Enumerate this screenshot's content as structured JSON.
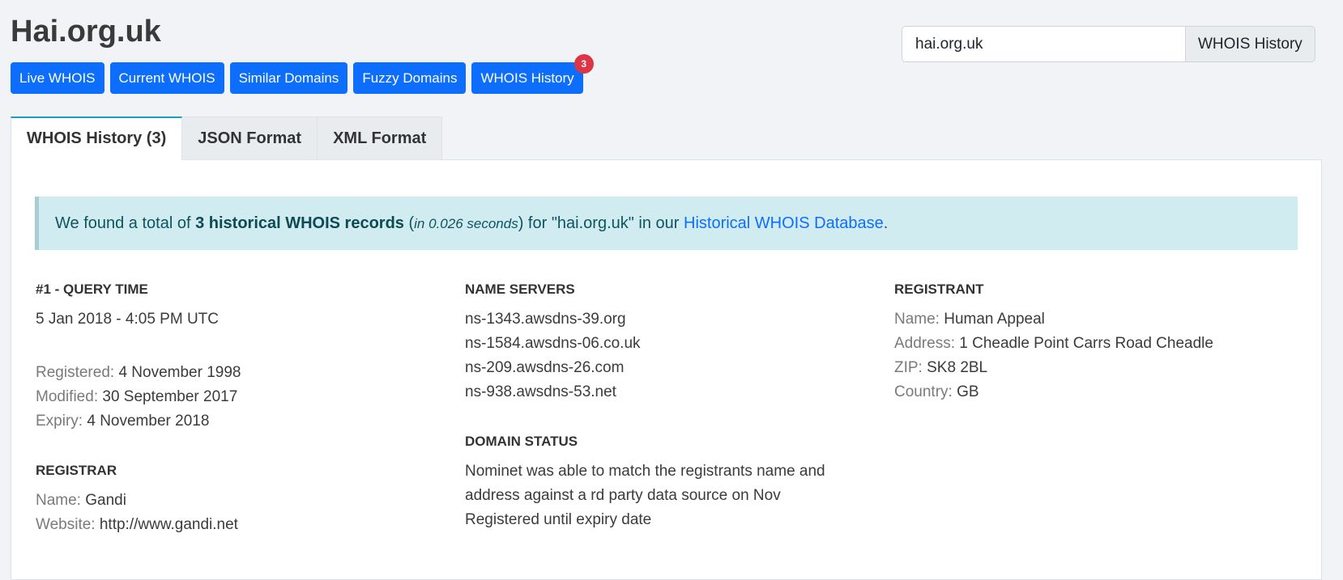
{
  "page": {
    "title": "Hai.org.uk"
  },
  "nav": {
    "buttons": [
      "Live WHOIS",
      "Current WHOIS",
      "Similar Domains",
      "Fuzzy Domains",
      "WHOIS History"
    ],
    "history_badge": "3"
  },
  "search": {
    "value": "hai.org.uk",
    "button_label": "WHOIS History"
  },
  "tabs": [
    "WHOIS History (3)",
    "JSON Format",
    "XML Format"
  ],
  "alert": {
    "prefix": "We found a total of ",
    "count_text": "3 historical WHOIS records",
    "paren_open": " (",
    "time_text": "in 0.026 seconds",
    "paren_close": ") for \"",
    "domain": "hai.org.uk",
    "middle": "\" in our ",
    "link_text": "Historical WHOIS Database",
    "suffix": "."
  },
  "record": {
    "query_heading": "#1 - QUERY TIME",
    "query_time": "5 Jan 2018 - 4:05 PM UTC",
    "dates": [
      {
        "label": "Registered:",
        "value": "4 November 1998"
      },
      {
        "label": "Modified:",
        "value": "30 September 2017"
      },
      {
        "label": "Expiry:",
        "value": "4 November 2018"
      }
    ],
    "registrar_heading": "REGISTRAR",
    "registrar": [
      {
        "label": "Name:",
        "value": "Gandi"
      },
      {
        "label": "Website:",
        "value": "http://www.gandi.net"
      }
    ],
    "ns_heading": "NAME SERVERS",
    "name_servers": [
      "ns-1343.awsdns-39.org",
      "ns-1584.awsdns-06.co.uk",
      "ns-209.awsdns-26.com",
      "ns-938.awsdns-53.net"
    ],
    "status_heading": "DOMAIN STATUS",
    "status_lines": [
      "Nominet was able to match the registrants name and",
      "address against a rd party data source on Nov",
      "Registered until expiry date"
    ],
    "registrant_heading": "REGISTRANT",
    "registrant": [
      {
        "label": "Name:",
        "value": "Human Appeal"
      },
      {
        "label": "Address:",
        "value": "1 Cheadle Point Carrs Road Cheadle"
      },
      {
        "label": "ZIP:",
        "value": "SK8 2BL"
      },
      {
        "label": "Country:",
        "value": "GB"
      }
    ]
  }
}
